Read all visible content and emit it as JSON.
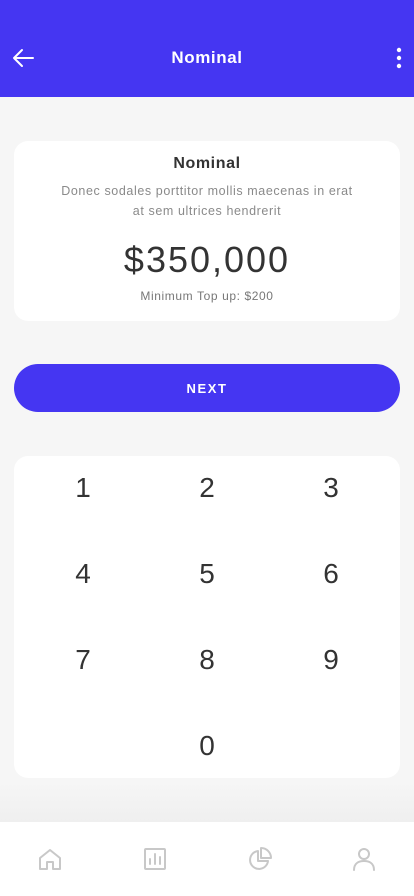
{
  "header": {
    "title": "Nominal",
    "back_icon": "arrow-left-icon",
    "menu_icon": "more-vertical-icon"
  },
  "card": {
    "title": "Nominal",
    "description": "Donec sodales porttitor mollis maecenas in erat at sem ultrices hendrerit",
    "amount": "$350,000",
    "minimum": "Minimum Top up: $200"
  },
  "next_button": {
    "label": "NEXT"
  },
  "keypad": {
    "keys": [
      "1",
      "2",
      "3",
      "4",
      "5",
      "6",
      "7",
      "8",
      "9",
      "0"
    ]
  },
  "tabbar": {
    "items": [
      {
        "icon": "home-icon"
      },
      {
        "icon": "bar-chart-icon"
      },
      {
        "icon": "pie-chart-icon"
      },
      {
        "icon": "user-icon"
      }
    ]
  },
  "colors": {
    "accent": "#4536f2",
    "background": "#f6f6f6",
    "icon_inactive": "#c8c8c8"
  }
}
